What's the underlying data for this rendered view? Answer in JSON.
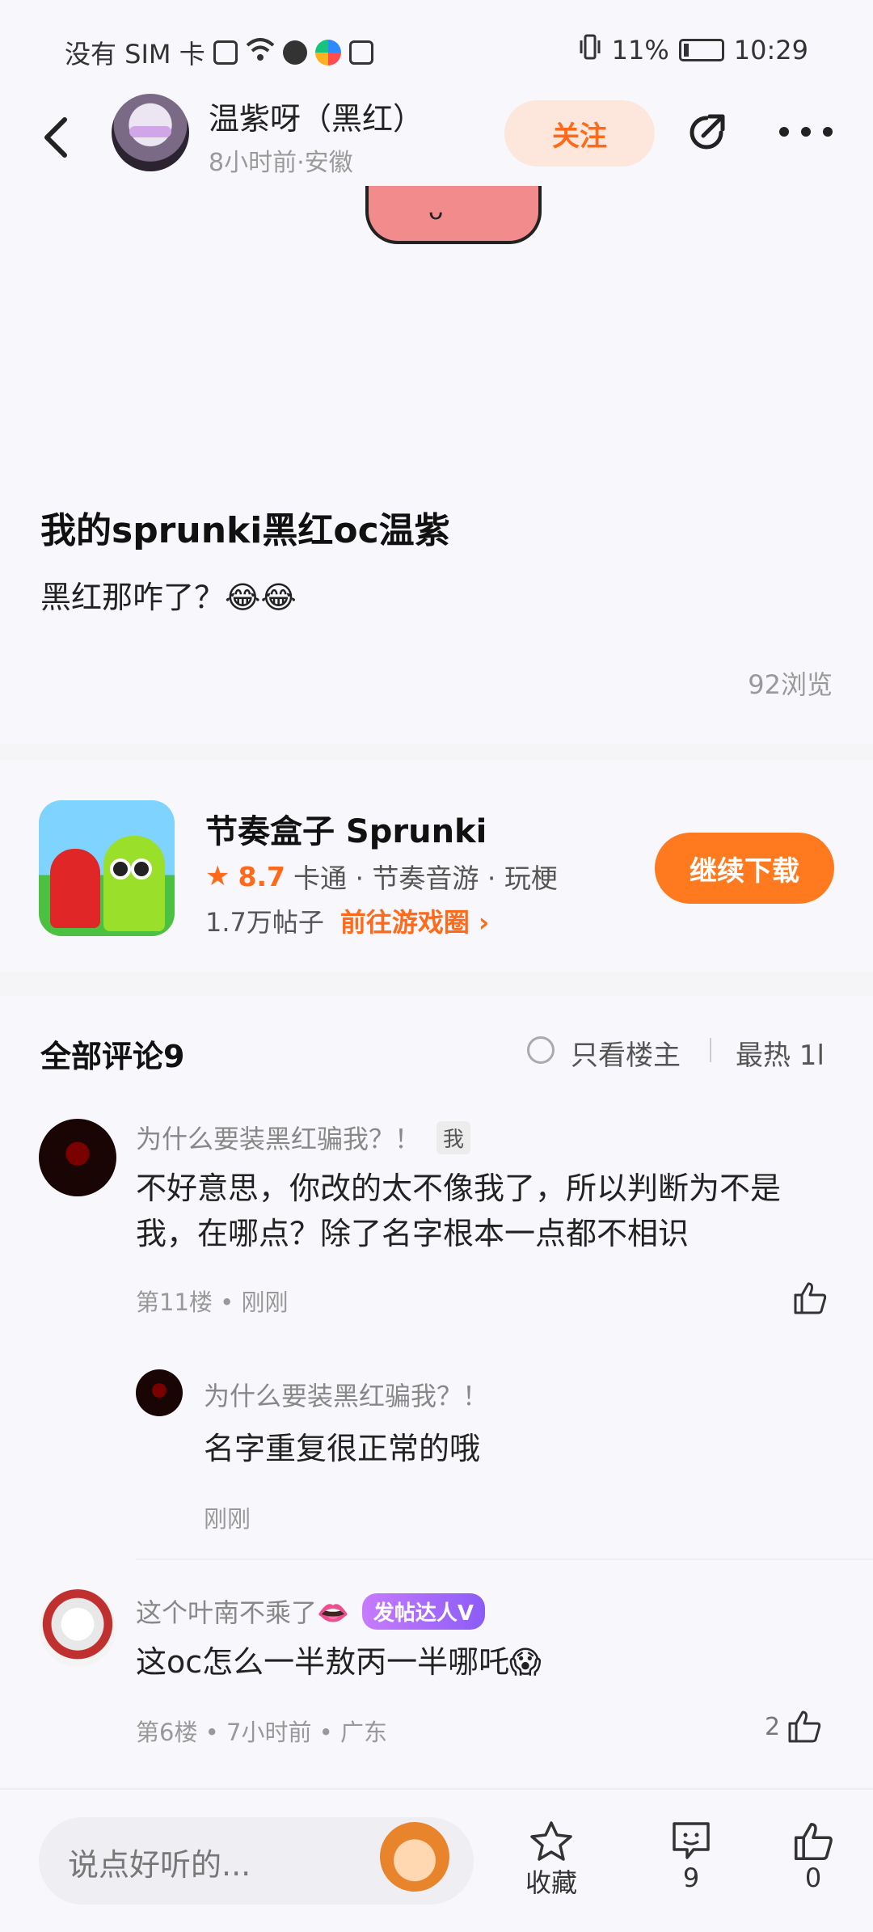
{
  "status_bar": {
    "carrier": "没有 SIM 卡",
    "battery_percent": "11%",
    "time": "10:29"
  },
  "header": {
    "author_name": "温紫呀（黑红）",
    "author_meta": "8小时前·安徽",
    "follow_label": "关注"
  },
  "post": {
    "title": "我的sprunki黑红oc温紫",
    "body": "黑红那咋了？😂😂",
    "views": "92浏览"
  },
  "game": {
    "title": "节奏盒子 Sprunki",
    "rating": "8.7",
    "tags": "卡通 · 节奏音游 · 玩梗",
    "posts": "1.7万帖子",
    "link_label": "前往游戏圈 ›",
    "download_label": "继续下载"
  },
  "comments_section": {
    "header": "全部评论9",
    "only_op_label": "只看楼主",
    "sort_label": "最热 1l",
    "items": [
      {
        "username": "为什么要装黑红骗我？！",
        "badge": "我",
        "text": "不好意思，你改的太不像我了，所以判断为不是我，在哪点？除了名字根本一点都不相识",
        "meta": "第11楼 • 刚刚",
        "likes": ""
      },
      {
        "username": "为什么要装黑红骗我？！",
        "text": "名字重复很正常的哦",
        "meta": "刚刚"
      },
      {
        "username": "这个叶南不乘了👄",
        "badge": "发帖达人V",
        "text": "这oc怎么一半敖丙一半哪吒😱",
        "meta": "第6楼 • 7小时前 • 广东",
        "likes": "2"
      }
    ]
  },
  "bottom_bar": {
    "input_placeholder": "说点好听的...",
    "favorite_label": "收藏",
    "comment_count": "9",
    "like_count": "0"
  }
}
